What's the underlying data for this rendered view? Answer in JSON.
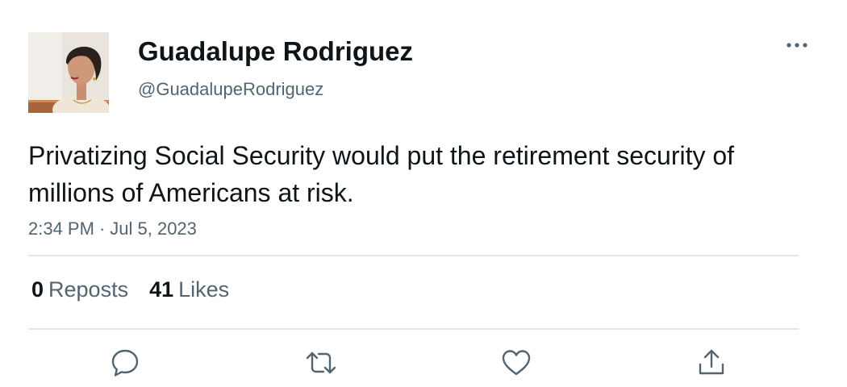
{
  "author": {
    "display_name": "Guadalupe Rodriguez",
    "handle": "@GuadalupeRodriguez",
    "avatar_icon": "profile-photo"
  },
  "tweet": {
    "text": "Privatizing Social Security would put the retirement security of millions of Americans at risk.",
    "time": "2:34 PM",
    "separator": "·",
    "date": "Jul 5, 2023"
  },
  "stats": {
    "reposts_count": "0",
    "reposts_label": "Reposts",
    "likes_count": "41",
    "likes_label": "Likes"
  },
  "actions": {
    "reply_icon": "speech-bubble-icon",
    "repost_icon": "repost-arrows-icon",
    "like_icon": "heart-icon",
    "share_icon": "share-upload-icon",
    "more_icon": "more-horizontal-icon"
  },
  "colors": {
    "primary_text": "#0f1419",
    "secondary_text": "#536471",
    "divider": "#e1e6ea"
  }
}
